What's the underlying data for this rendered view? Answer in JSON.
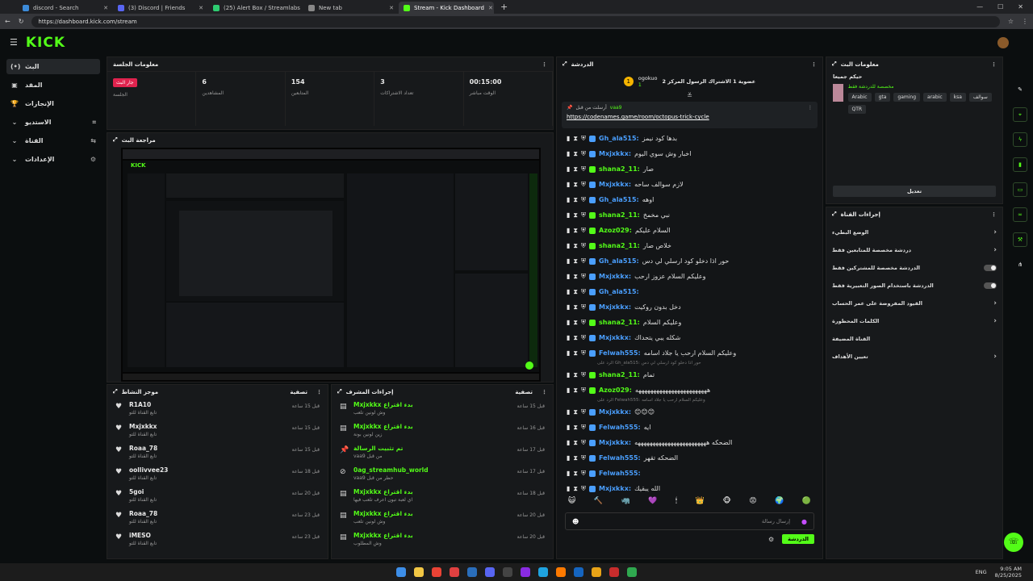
{
  "browser": {
    "tabs": [
      {
        "label": "discord - Search",
        "color": "#3c8bd9"
      },
      {
        "label": "(3) Discord | Friends",
        "color": "#5865f2"
      },
      {
        "label": "(25) Alert Box / Streamlabs",
        "color": "#2ecc71"
      },
      {
        "label": "New tab",
        "color": "#888888"
      },
      {
        "label": "Stream - Kick Dashboard",
        "color": "#53fc18",
        "active": true
      }
    ],
    "url": "https://dashboard.kick.com/stream"
  },
  "brand": {
    "logo": "KICK",
    "accent": "#53fc18"
  },
  "nav": [
    {
      "icon": "(•)",
      "label": "البث",
      "selected": true
    },
    {
      "icon": "▣",
      "label": "المقد"
    },
    {
      "icon": "🏆",
      "label": "الإنجازات"
    },
    {
      "icon": "⌄",
      "label": "الاستديو",
      "right": "⌗"
    },
    {
      "icon": "⌄",
      "label": "القناة",
      "right": "⇆"
    },
    {
      "icon": "⌄",
      "label": "الإعدادات",
      "right": "⚙"
    }
  ],
  "session": {
    "title": "معلومات الجلسة",
    "cells": [
      {
        "value": "",
        "label": "الجلسة",
        "badge": "جار البث"
      },
      {
        "value": "6",
        "label": "المشاهدين"
      },
      {
        "value": "154",
        "label": "المتابعين"
      },
      {
        "value": "3",
        "label": "تعداد الاشتراكات"
      },
      {
        "value": "00:15:00",
        "label": "الوقت مباشر"
      }
    ]
  },
  "preview": {
    "title": "مراجعة البث"
  },
  "activity": {
    "title": "موجز النشاط",
    "filter": "تصفية",
    "items": [
      {
        "name": "R1A10",
        "sub": "تابع القناة للتو",
        "time": "قبل 15 ساعة"
      },
      {
        "name": "Mxjxkkx",
        "sub": "تابع القناة للتو",
        "time": "قبل 15 ساعة"
      },
      {
        "name": "Roaa_78",
        "sub": "تابع القناة للتو",
        "time": "قبل 15 ساعة"
      },
      {
        "name": "oollivvee23",
        "sub": "تابع القناة للتو",
        "time": "قبل 18 ساعة"
      },
      {
        "name": "5goi",
        "sub": "تابع القناة للتو",
        "time": "قبل 20 ساعة"
      },
      {
        "name": "Roaa_78",
        "sub": "تابع القناة للتو",
        "time": "قبل 23 ساعة"
      },
      {
        "name": "iMESO",
        "sub": "تابع القناة للتو",
        "time": "قبل 23 ساعة"
      }
    ]
  },
  "modactions": {
    "title": "إجراءات المشرف",
    "filter": "تصفية",
    "items": [
      {
        "icon": "▤",
        "name": "Mxjxkkx بدء اقتراع",
        "sub": "وش لونين تلعب",
        "time": "قبل 15 ساعة"
      },
      {
        "icon": "▤",
        "name": "Mxjxkkx بدء اقتراع",
        "sub": "زين لونين بونة",
        "time": "قبل 16 ساعة"
      },
      {
        "icon": "📌",
        "name": "تم تثبيت الرسالة",
        "sub": "vaa9 من قبل",
        "time": "قبل 17 ساعة"
      },
      {
        "icon": "⊘",
        "name": "0ag_streamhub_world",
        "sub": "vaa9 حظر من قبل",
        "time": "قبل 17 ساعة"
      },
      {
        "icon": "▤",
        "name": "Mxjxkkx بدء اقتراع",
        "sub": "اي لعبة تبون اعرف تلعب فيها",
        "time": "قبل 18 ساعة"
      },
      {
        "icon": "▤",
        "name": "Mxjxkkx بدء اقتراع",
        "sub": "وش لونين تلعب",
        "time": "قبل 20 ساعة"
      },
      {
        "icon": "▤",
        "name": "Mxjxkkx بدء اقتراع",
        "sub": "وش المطلوب",
        "time": "قبل 20 ساعة"
      }
    ]
  },
  "chat": {
    "title": "الدردشة",
    "leader": {
      "name": "ogokuo",
      "count": "1",
      "text": "عضوية 1 الاشتراك الرسول المركز 2"
    },
    "pinned": {
      "by": "vaa9",
      "label": "أرسلت من قبل",
      "link": "https://codenames.game/room/octopus-trick-cycle"
    },
    "messages": [
      {
        "user": "Gh_ala515",
        "color": "#4a9fff",
        "text": "بدها كود نيمز"
      },
      {
        "user": "Mxjxkkx",
        "color": "#4a9fff",
        "text": "اخبار وش سوي اليوم"
      },
      {
        "user": "shana2_11",
        "color": "#53fc18",
        "text": "صار"
      },
      {
        "user": "Mxjxkkx",
        "color": "#4a9fff",
        "text": "لازم سوالف ساحه"
      },
      {
        "user": "Gh_ala515",
        "color": "#4a9fff",
        "text": "اوهه"
      },
      {
        "user": "shana2_11",
        "color": "#53fc18",
        "text": "نبي مخمخ"
      },
      {
        "user": "Azoz029",
        "color": "#53fc18",
        "text": "السلام عليكم"
      },
      {
        "user": "shana2_11",
        "color": "#53fc18",
        "text": "خلاص صار"
      },
      {
        "user": "Gh_ala515",
        "color": "#4a9fff",
        "text": "حور اذا دخلو كود ارسلي لي دس"
      },
      {
        "user": "Mxjxkkx",
        "color": "#4a9fff",
        "text": "وعليكم السلام عزوز ارحب"
      },
      {
        "user": "Gh_ala515",
        "color": "#4a9fff",
        "text": ""
      },
      {
        "user": "Mxjxkkx",
        "color": "#4a9fff",
        "text": "دخل بدون روكيت"
      },
      {
        "user": "shana2_11",
        "color": "#53fc18",
        "text": "وعليكم السلام"
      },
      {
        "user": "Mxjxkkx",
        "color": "#4a9fff",
        "text": "شكله يبي يتحداك"
      },
      {
        "user": "Felwah555",
        "color": "#4a9fff",
        "text": "وعليكم السلام ارحب يا جلاد اسامه"
      },
      {
        "reply": "الرد على Gh_ala515: حور اذا دخلو كود ارسلي لي دس"
      },
      {
        "user": "shana2_11",
        "color": "#53fc18",
        "text": "تمام"
      },
      {
        "user": "Azoz029",
        "color": "#53fc18",
        "text": "ههههههههههههههههههههههههه"
      },
      {
        "reply": "الرد على Felwah555: وعليكم السلام ارحب يا جلاد اسامه"
      },
      {
        "user": "Mxjxkkx",
        "color": "#4a9fff",
        "text": "😊😊😊"
      },
      {
        "user": "Felwah555",
        "color": "#4a9fff",
        "text": "ايه"
      },
      {
        "user": "Mxjxkkx",
        "color": "#4a9fff",
        "text": "الضحكه ههههههههههههههههههههههههه"
      },
      {
        "user": "Felwah555",
        "color": "#4a9fff",
        "text": "الضحكه تقهر"
      },
      {
        "user": "Felwah555",
        "color": "#4a9fff",
        "text": ""
      },
      {
        "user": "Mxjxkkx",
        "color": "#4a9fff",
        "text": "الله يبقيك"
      }
    ],
    "input_placeholder": "إرسال رسالة",
    "send_label": "الدردشة"
  },
  "streaminfo": {
    "title": "معلومات البث",
    "stream_title": "حيكم جميعا",
    "category": "مخصصة للدردشة فقط",
    "tags": [
      "Arabic",
      "gta",
      "gaming",
      "arabic",
      "ksa",
      "سوالف",
      "QTR"
    ],
    "edit": "تعديل"
  },
  "channelactions": {
    "title": "إجراءات القناة",
    "rows": [
      {
        "label": "الوضع البطيء",
        "kind": "arrow"
      },
      {
        "label": "دردشة مخصصة للمتابعين فقط",
        "kind": "arrow"
      },
      {
        "label": "الدردشة مخصصة للمشتركين فقط",
        "kind": "toggle"
      },
      {
        "label": "الدردشة باستخدام الصور التعبيرية فقط",
        "kind": "toggle"
      },
      {
        "label": "القيود المفروضة على عمر الحساب",
        "kind": "arrow"
      },
      {
        "label": "الكلمات المحظورة",
        "kind": "arrow"
      },
      {
        "label": "القناة المضيفة",
        "kind": "none"
      },
      {
        "label": "تعيين الأهداف",
        "kind": "arrow"
      }
    ]
  },
  "taskbar": {
    "lang": "ENG",
    "time": "9:05 AM",
    "date": "8/25/2025"
  }
}
